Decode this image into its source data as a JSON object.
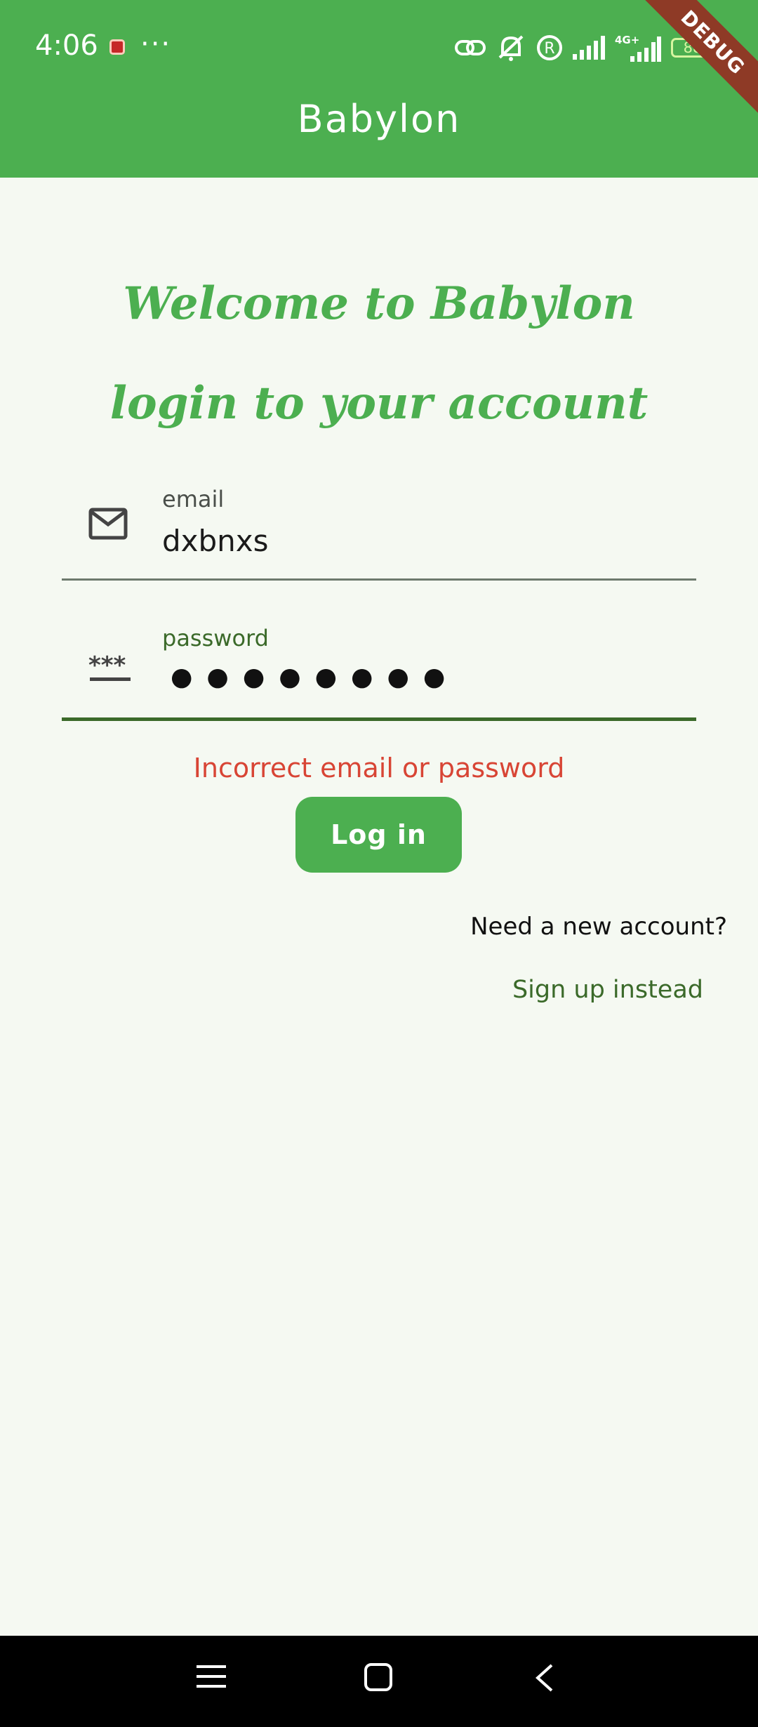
{
  "status_bar": {
    "time": "4:06",
    "more": "···",
    "battery": "88"
  },
  "debug_banner": "DEBUG",
  "app_bar": {
    "title": "Babylon"
  },
  "heading": {
    "line1": "Welcome to Babylon",
    "line2": "login to your account"
  },
  "email_field": {
    "label": "email",
    "value": "dxbnxs",
    "icon": "mail-icon"
  },
  "password_field": {
    "label": "password",
    "masked_value": "●●●●●●●●",
    "icon": "password-icon"
  },
  "error_message": "Incorrect email or password",
  "login_button": "Log in",
  "signup_prompt": "Need a new account?",
  "signup_link": "Sign up instead",
  "colors": {
    "primary": "#4caf50",
    "background": "#f5f9f2",
    "error": "#d84535",
    "focus": "#3b6a2a"
  },
  "nav_bar": {
    "icons": [
      "menu-icon",
      "home-icon",
      "back-icon"
    ]
  }
}
